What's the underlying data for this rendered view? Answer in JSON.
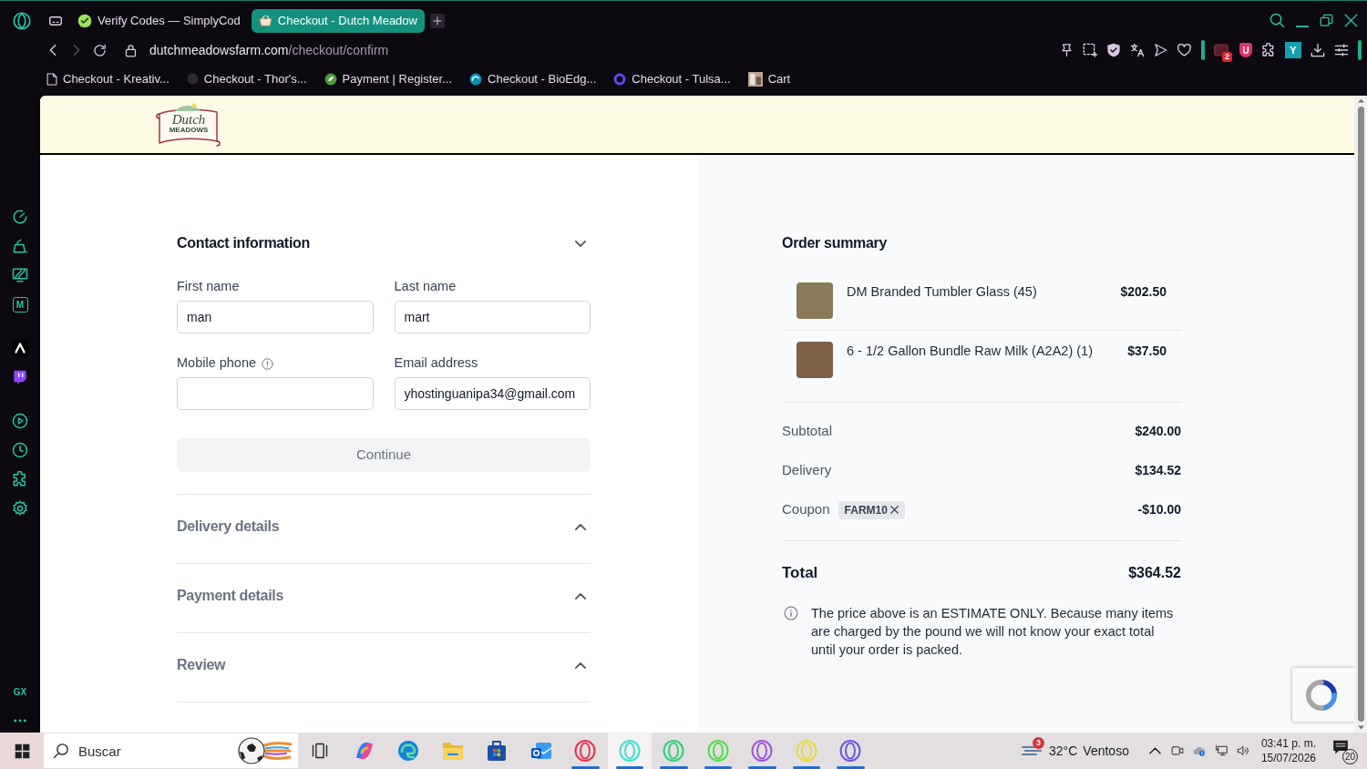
{
  "browser": {
    "tabs": [
      {
        "title": "Verify Codes — SimplyCod",
        "kind": "check",
        "selected": false
      },
      {
        "title": "Checkout - Dutch Meadow",
        "kind": "basket",
        "selected": true
      }
    ],
    "address": {
      "domain": "dutchmeadowsfarm.com",
      "path": "/checkout/confirm"
    },
    "extensions": {
      "badge": "2",
      "shield_letter": "U",
      "profile_letter": "Y"
    },
    "bookmarks": [
      {
        "title": "Checkout - Kreativ...",
        "kind": "page"
      },
      {
        "title": "Checkout - Thor's...",
        "kind": "dark"
      },
      {
        "title": "Payment | Register...",
        "kind": "leaf"
      },
      {
        "title": "Checkout - BioEdg...",
        "kind": "swirl"
      },
      {
        "title": "Checkout - Tulsa...",
        "kind": "ring"
      },
      {
        "title": "Cart",
        "kind": "photo"
      }
    ]
  },
  "sidebar": {
    "tile_letter": "M",
    "brand": "GX"
  },
  "page": {
    "logo": {
      "title": "Dutch",
      "subtitle": "MEADOWS"
    },
    "sections": [
      {
        "title": "Contact information",
        "expanded": true,
        "fields": [
          {
            "label": "First name",
            "value": "man",
            "info": false
          },
          {
            "label": "Last name",
            "value": "mart",
            "info": false
          },
          {
            "label": "Mobile phone",
            "info": true
          },
          {
            "label": "Email address",
            "value": "yhostinguanipa34@gmail.com",
            "info": false
          }
        ],
        "button": {
          "label": "Continue",
          "disabled": true
        }
      },
      {
        "title": "Delivery details",
        "expanded": false
      },
      {
        "title": "Payment details",
        "expanded": false
      },
      {
        "title": "Review",
        "expanded": false
      }
    ],
    "order_summary": {
      "title": "Order summary",
      "items": [
        {
          "name": "DM Branded Tumbler Glass (45)",
          "price": "$202.50"
        },
        {
          "name": "6 - 1/2 Gallon Bundle Raw Milk (A2A2) (1)",
          "price": "$37.50"
        }
      ],
      "totals": [
        {
          "kind": "line",
          "label": "Subtotal",
          "value": "$240.00"
        },
        {
          "kind": "line",
          "label": "Delivery",
          "value": "$134.52"
        },
        {
          "kind": "coupon",
          "label": "Coupon",
          "code": "FARM10",
          "value": "-$10.00"
        },
        {
          "kind": "total",
          "label": "Total",
          "value": "$364.52"
        }
      ],
      "note": "The price above is an ESTIMATE ONLY. Because many items are charged by the pound we will not know your exact total until your order is packed."
    }
  },
  "taskbar": {
    "search": {
      "placeholder": "Buscar"
    },
    "apps": [
      {
        "kind": "task-view",
        "running": false,
        "selected": false
      },
      {
        "kind": "ribbon",
        "running": false,
        "selected": false
      },
      {
        "kind": "edge",
        "running": false,
        "selected": false
      },
      {
        "kind": "folder",
        "running": false,
        "selected": false
      },
      {
        "kind": "store",
        "running": false,
        "selected": false
      },
      {
        "kind": "mail",
        "running": false,
        "selected": false
      },
      {
        "kind": "ring",
        "color": "#e8344e",
        "running": true,
        "selected": false
      },
      {
        "kind": "ring",
        "color": "#3fe0d0",
        "running": true,
        "selected": true
      },
      {
        "kind": "ring",
        "color": "#2fd07a",
        "running": true,
        "selected": false
      },
      {
        "kind": "ring",
        "color": "#4fdc4f",
        "running": true,
        "selected": false
      },
      {
        "kind": "ring",
        "color": "#9b59d9",
        "running": true,
        "selected": false
      },
      {
        "kind": "ring",
        "color": "#e6d94a",
        "running": true,
        "selected": false
      },
      {
        "kind": "ring",
        "color": "#6a5ae0",
        "running": true,
        "selected": false
      }
    ],
    "weather": {
      "alerts": "3",
      "temperature": "32°C",
      "condition": "Ventoso"
    },
    "clock": {
      "time": "03:41 p. m.",
      "date": "15/07/2026"
    },
    "notifications": "20"
  }
}
